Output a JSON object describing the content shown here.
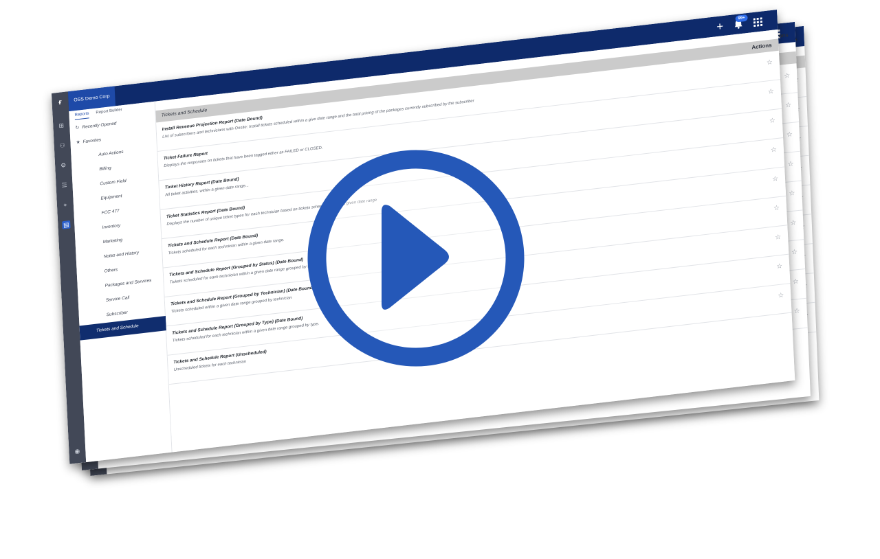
{
  "app": {
    "brand_tab": "OSS Demo Corp",
    "notification_badge": "99+",
    "colors": {
      "topbar": "#0e2a6b",
      "rail": "#424857",
      "accent": "#1e4aa8",
      "selected": "#102d6e",
      "play": "#2558b8"
    }
  },
  "sidebar": {
    "tabs": [
      {
        "label": "Reports",
        "active": true
      },
      {
        "label": "Report Builder",
        "active": false
      }
    ],
    "recent": "Recently Opened",
    "favorites": "Favorites",
    "categories": [
      "Auto Actions",
      "Billing",
      "Custom Field",
      "Equipment",
      "FCC 477",
      "Inventory",
      "Marketing",
      "Notes and History",
      "Others",
      "Packages and Services",
      "Service Call",
      "Subscriber",
      "Tickets and Schedule"
    ],
    "selected": "Tickets and Schedule"
  },
  "main": {
    "panel_title": "Tickets and Schedule",
    "actions_label": "Actions",
    "reports": [
      {
        "title": "Install Revenue Projection Report (Date Bound)",
        "desc": "List of subscribers and technicians with Onsite: Install tickets scheduled within a give date range and the total pricing of the packages currently subscribed by the subscriber"
      },
      {
        "title": "Ticket Failure Report",
        "desc": "Displays the responses on tickets that have been tagged either as FAILED or CLOSED."
      },
      {
        "title": "Ticket History Report (Date Bound)",
        "desc": "All ticket activities, within a given date range..."
      },
      {
        "title": "Ticket Statistics Report (Date Bound)",
        "desc": "Displays the number of unique ticket types for each technician based on tickets scheduled within a given date range"
      },
      {
        "title": "Tickets and Schedule Report (Date Bound)",
        "desc": "Tickets scheduled for each technician within a given date range."
      },
      {
        "title": "Tickets and Schedule Report (Grouped by Status) (Date Bound)",
        "desc": "Tickets scheduled for each technician within a given date range grouped by status."
      },
      {
        "title": "Tickets and Schedule Report (Grouped by Technician) (Date Bound)",
        "desc": "Tickets scheduled within a given date range grouped by technician"
      },
      {
        "title": "Tickets and Schedule Report (Grouped by Type) (Date Bound)",
        "desc": "Tickets scheduled for each technician within a given date range grouped by type."
      },
      {
        "title": "Tickets and Schedule Report (Unscheduled)",
        "desc": "Unscheduled tickets for each technician"
      }
    ]
  },
  "icons": {
    "plus": "plus-icon",
    "bell": "bell-icon",
    "apps": "apps-grid-icon",
    "play": "play-icon",
    "star": "star-icon",
    "history": "history-icon",
    "favorite": "star-filled-icon"
  }
}
